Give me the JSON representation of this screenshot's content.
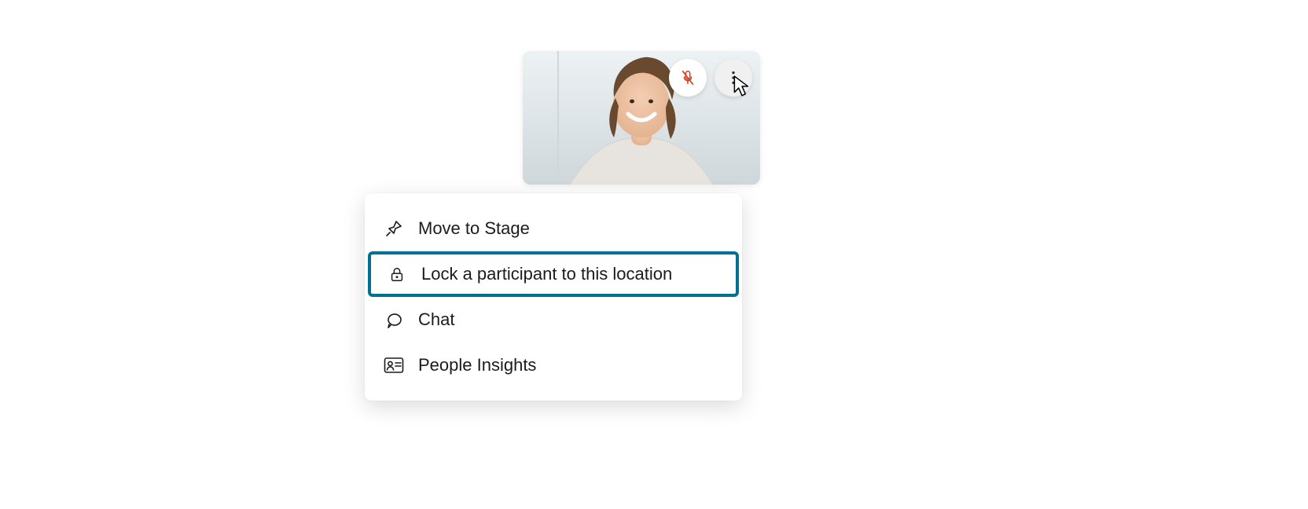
{
  "tile": {
    "mute_icon": "mic-muted-icon",
    "more_icon": "more-options-icon"
  },
  "menu": {
    "items": [
      {
        "icon": "pin-icon",
        "label": "Move to Stage",
        "highlighted": false
      },
      {
        "icon": "lock-icon",
        "label": "Lock a participant to this location",
        "highlighted": true
      },
      {
        "icon": "chat-icon",
        "label": "Chat",
        "highlighted": false
      },
      {
        "icon": "id-card-icon",
        "label": "People Insights",
        "highlighted": false
      }
    ]
  }
}
